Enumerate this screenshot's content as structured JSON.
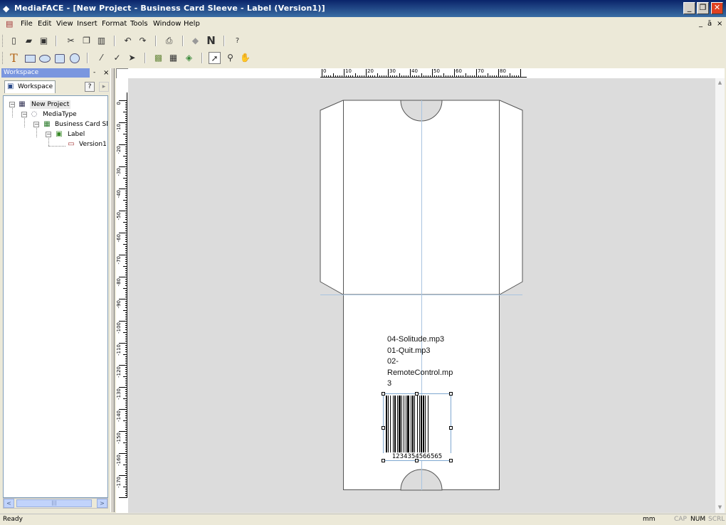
{
  "window": {
    "title": "MediaFACE - [New Project - Business Card Sleeve - Label (Version1)]",
    "buttons": {
      "minimize": "_",
      "restore": "❐",
      "close": "✕"
    }
  },
  "menu": {
    "items": [
      "File",
      "Edit",
      "View",
      "Insert",
      "Format",
      "Tools",
      "Window",
      "Help"
    ],
    "mdi_controls": [
      "_",
      "ā",
      "×"
    ]
  },
  "toolbar1": {
    "icons": [
      "new-icon",
      "open-icon",
      "save-icon",
      "cut-icon",
      "copy-icon",
      "paste-icon",
      "undo-icon",
      "redo-icon",
      "print-icon",
      "eraser-icon",
      "n-icon",
      "help-icon"
    ],
    "n_label": "N",
    "help_label": "?"
  },
  "toolbar2": {
    "text_label": "T",
    "icons": [
      "text-tool-icon",
      "rectangle-tool-icon",
      "ellipse-tool-icon",
      "rounded-rect-tool-icon",
      "circle-tool-icon",
      "line-tool-icon",
      "pen-tool-icon",
      "fill-tool-icon",
      "image-tool-icon",
      "barcode-tool-icon",
      "shape-tool-icon",
      "pointer-tool-icon",
      "zoom-tool-icon",
      "hand-tool-icon"
    ]
  },
  "workspace": {
    "panel_title": "Workspace",
    "pin": "-",
    "close": "×",
    "tab_label": "Workspace",
    "help": "?",
    "nav": "▸",
    "tree": [
      {
        "label": "New Project",
        "level": 0,
        "expander": "−",
        "icon": "project-icon"
      },
      {
        "label": "MediaType",
        "level": 1,
        "expander": "−",
        "icon": "mediatype-icon"
      },
      {
        "label": "Business Card Sleeve",
        "level": 2,
        "expander": "−",
        "icon": "business-card-icon"
      },
      {
        "label": "Label",
        "level": 3,
        "expander": "−",
        "icon": "label-icon"
      },
      {
        "label": "Version1",
        "level": 4,
        "expander": "",
        "icon": "version-icon"
      }
    ],
    "scroll": {
      "left": "<",
      "right": ">",
      "thumb": "|||"
    }
  },
  "rulers": {
    "horizontal_labels": [
      "0",
      "10",
      "20",
      "30",
      "40",
      "50",
      "60",
      "70",
      "80"
    ],
    "vertical_labels": [
      "0",
      "-10",
      "-20",
      "-30",
      "-40",
      "-50",
      "-60",
      "-70",
      "-80",
      "-90",
      "-100",
      "-110",
      "-120",
      "-130",
      "-140",
      "-150",
      "-160",
      "-170"
    ]
  },
  "label": {
    "tracks": [
      "04-Solitude.mp3",
      "01-Quit.mp3",
      "02-",
      "RemoteControl.mp",
      "3"
    ],
    "barcode_number": "1234354566565"
  },
  "status": {
    "text": "Ready",
    "unit": "mm",
    "indicators": [
      "CAP",
      "NUM",
      "SCRL"
    ]
  }
}
